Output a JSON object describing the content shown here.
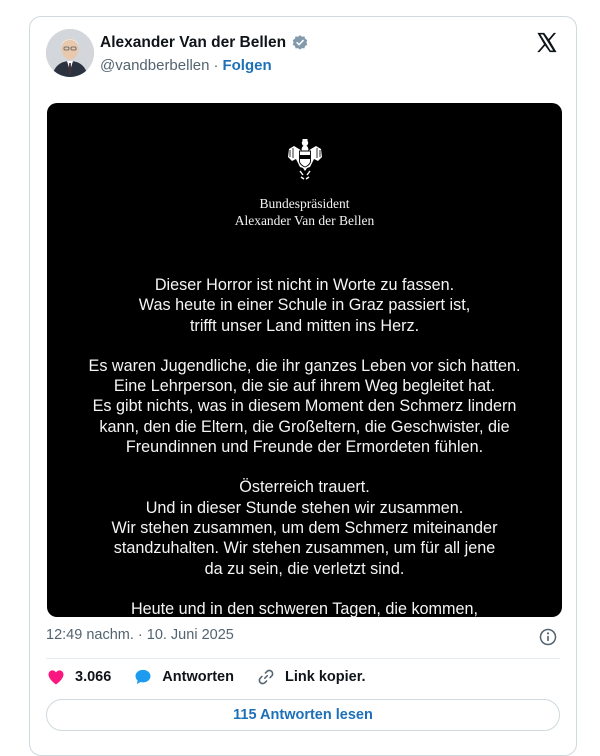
{
  "author": {
    "display_name": "Alexander Van der Bellen",
    "handle": "@vandberbellen",
    "separator": "·",
    "follow_label": "Folgen",
    "verified": true,
    "avatar_icon": "portrait-avatar"
  },
  "brand_icon": "x-logo-icon",
  "media": {
    "emblem_icon": "austrian-eagle-icon",
    "office_line1": "Bundespräsident",
    "office_line2": "Alexander Van der Bellen",
    "paragraphs": [
      [
        "Dieser Horror ist nicht in Worte zu fassen.",
        "Was heute in einer Schule in Graz passiert ist,",
        "trifft unser Land mitten ins Herz."
      ],
      [
        "Es waren Jugendliche, die ihr ganzes Leben vor sich hatten.",
        "Eine Lehrperson, die sie auf ihrem Weg begleitet hat.",
        "Es gibt nichts, was in diesem Moment den Schmerz lindern",
        "kann, den die Eltern, die Großeltern, die Geschwister, die",
        "Freundinnen und Freunde der Ermordeten fühlen."
      ],
      [
        "Österreich trauert.",
        "Und in dieser Stunde stehen wir zusammen.",
        "Wir stehen zusammen, um dem Schmerz miteinander",
        "standzuhalten. Wir stehen zusammen, um für all jene",
        "da zu sein, die verletzt sind."
      ],
      [
        "Heute und in den schweren Tagen, die kommen,"
      ]
    ]
  },
  "timestamp": "12:49 nachm. · 10. Juni 2025",
  "actions": {
    "likes_count": "3.066",
    "reply_label": "Antworten",
    "copy_link_label": "Link kopier."
  },
  "read_replies_label": "115 Antworten lesen",
  "colors": {
    "link_blue": "#1d70b8",
    "like_pink": "#f91880",
    "reply_blue": "#1d9bf0",
    "muted_text": "#536471"
  }
}
